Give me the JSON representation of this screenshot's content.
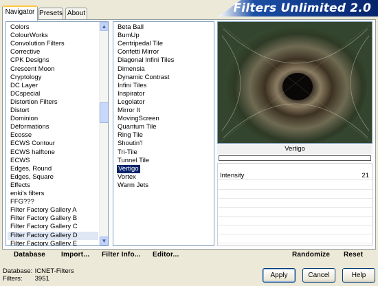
{
  "tabs": [
    {
      "label": "Navigator"
    },
    {
      "label": "Presets"
    },
    {
      "label": "About"
    }
  ],
  "brand_title": "Filters Unlimited 2.0",
  "categories": [
    "Colors",
    "ColourWorks",
    "Convolution Filters",
    "Corrective",
    "CPK Designs",
    "Crescent Moon",
    "Cryptology",
    "DC Layer",
    "DCspecial",
    "Distortion Filters",
    "Distort",
    "Dominion",
    "Déformations",
    "Ecosse",
    "ECWS Contour",
    "ECWS halftone",
    "ECWS",
    "Edges, Round",
    "Edges, Square",
    "Effects",
    "enki's filters",
    "FFG???",
    "Filter Factory Gallery A",
    "Filter Factory Gallery B",
    "Filter Factory Gallery C",
    "Filter Factory Gallery D",
    "Filter Factory Gallery E"
  ],
  "selected_category": "Filter Factory Gallery D",
  "filters": [
    "Beta Ball",
    "BumUp",
    "Centripedal Tile",
    "Confetti Mirror",
    "Diagonal Infini Tiles",
    "Dimensia",
    "Dynamic Contrast",
    "Infini Tiles",
    "Inspirator",
    "Legolator",
    "Mirror It",
    "MovingScreen",
    "Quantum Tile",
    "Ring Tile",
    "Shoutin'!",
    "Tri-Tile",
    "Tunnel Tile",
    "Vertigo",
    "Vortex",
    "Warm Jets"
  ],
  "selected_filter": "Vertigo",
  "preview_filter_name": "Vertigo",
  "params": [
    {
      "label": "Intensity",
      "value": "21"
    }
  ],
  "buttons": {
    "database": "Database",
    "import": "Import...",
    "filter_info": "Filter Info...",
    "editor": "Editor...",
    "randomize": "Randomize",
    "reset": "Reset",
    "apply": "Apply",
    "cancel": "Cancel",
    "help": "Help"
  },
  "status": {
    "database_label": "Database:",
    "database_value": "ICNET-Filters",
    "filters_label": "Filters:",
    "filters_value": "3951"
  },
  "icons": {
    "scroll_up": "chevron-up-icon",
    "scroll_down": "chevron-down-icon"
  },
  "colors": {
    "selection": "#0a246a",
    "brand_dark": "#06236c"
  }
}
